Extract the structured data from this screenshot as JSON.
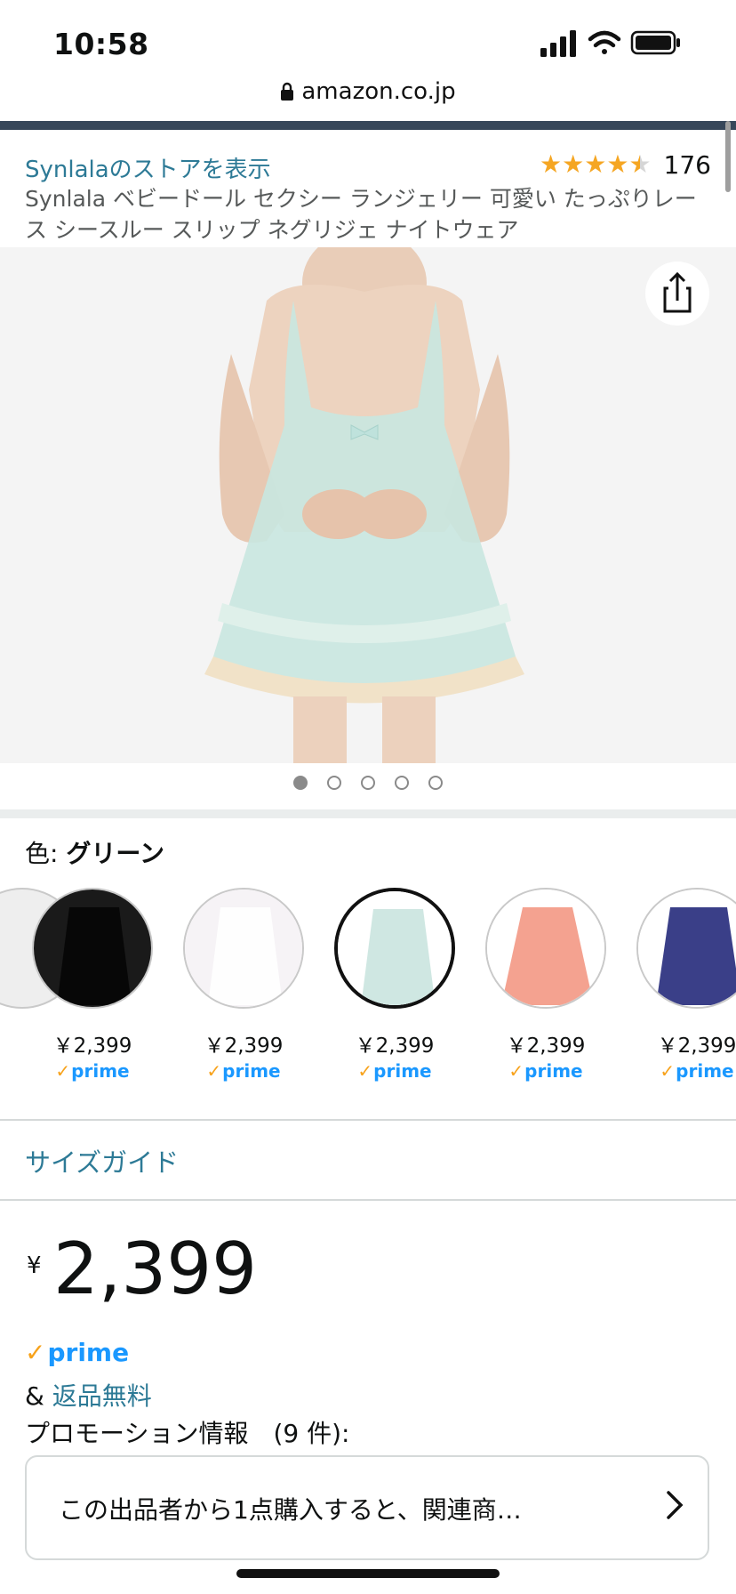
{
  "status_bar": {
    "time": "10:58"
  },
  "browser": {
    "url": "amazon.co.jp"
  },
  "product": {
    "store_link": "Synlalaのストアを表示",
    "rating_value": 4.5,
    "rating_count": "176",
    "title": "Synlala ベビードール セクシー ランジェリー 可愛い たっぷりレース シースルー スリップ ネグリジェ ナイトウェア",
    "image_count": 5,
    "active_image": 1
  },
  "color": {
    "label": "色:",
    "selected": "グリーン",
    "swatches": [
      {
        "name": "black",
        "fill": "#1a1a1a",
        "price": "￥2,399",
        "prime": "prime",
        "selected": false
      },
      {
        "name": "white",
        "fill": "#f6f3f6",
        "price": "￥2,399",
        "prime": "prime",
        "selected": false
      },
      {
        "name": "green",
        "fill": "#cfe7e2",
        "price": "￥2,399",
        "prime": "prime",
        "selected": true
      },
      {
        "name": "pink",
        "fill": "#f4a290",
        "price": "￥2,399",
        "prime": "prime",
        "selected": false
      },
      {
        "name": "navy",
        "fill": "#3a3f88",
        "price": "￥2,399",
        "prime": "prime",
        "selected": false
      }
    ]
  },
  "size_guide": "サイズガイド",
  "price": {
    "symbol": "¥",
    "amount": "2,399"
  },
  "prime_badge": "prime",
  "returns": {
    "prefix": "&",
    "link": "返品無料"
  },
  "promotion": {
    "header": "プロモーション情報　(9 件):",
    "card_text": "この出品者から1点購入すると、関連商…"
  },
  "colors": {
    "link": "#2d7a96",
    "prime_blue": "#1a98ff",
    "prime_check": "#f7a21b",
    "star": "#f5a623",
    "nav_bar": "#37475a"
  }
}
